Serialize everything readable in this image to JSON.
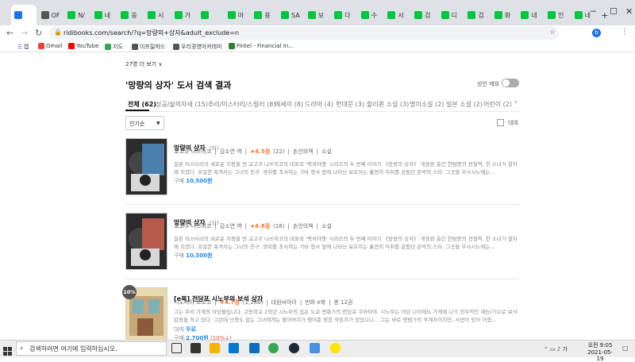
{
  "browser": {
    "tabs": [
      "",
      "OF",
      "N/",
      "네",
      "옹",
      "시",
      "가",
      "",
      "마",
      "용",
      "SA",
      "보",
      "다",
      "수",
      "서",
      "검",
      "디",
      "검",
      "화",
      "내",
      "인",
      "네"
    ],
    "url": "ridibooks.com/search/?q=망량의+상자&adult_exclude=n",
    "bookmarks": [
      "앱",
      "Gmail",
      "YouTube",
      "지도",
      "이프릴하드",
      "우리경영아카데미",
      "Fintel - Financial In..."
    ]
  },
  "page": {
    "more_link": "27명 더 보기 ∨",
    "heading": "'망량의 상자' 도서 검색 결과",
    "adult_exclude_label": "성인 제외",
    "filters": [
      "전체 (62)",
      "성공/삶의자세 (15)",
      "추리/미스터리/스릴러 (8)",
      "에세이 (8)",
      "드라마 (4)",
      "현대문 (3)",
      "할리퀸 소설 (3)",
      "명이소설 (2)",
      "일본 소설 (2)",
      "어린이 (2)"
    ],
    "sort_select": "인기순",
    "rent_label": "대여",
    "books": [
      {
        "title": "망량의 상자",
        "title_suffix": "(하)",
        "author": "교고쿠 나쓰히코",
        "translator": "김소연 역",
        "rating": "★4.5점",
        "rating_count": "(22)",
        "publisher": "손안의책",
        "category": "소설",
        "desc": "일본 미스터리의 새로운 지평을 연 교고쿠 나쓰히코의 대표작 '백귀야행' 시리즈의 두 번째 이야기 《망량의 상자》 개정판 출간 한밤중의 전철역, 한 소녀가 열차에 치였다. 유일한 목격자는 그녀의 친구. 경위를 조사하는 기바 형사 앞에 나타난 보호자는 홀연히 자취를 감췄던 은막의 스타. 그곳을 무사시노에는...",
        "price_label": "구매",
        "price": "10,500원"
      },
      {
        "title": "망량의 상자",
        "title_suffix": "(상)",
        "author": "교고쿠 나쓰히코",
        "translator": "김소연 역",
        "rating": "★4.8점",
        "rating_count": "(16)",
        "publisher": "손안의책",
        "category": "소설",
        "desc": "일본 미스터리의 새로운 지평을 연 교고쿠 나쓰히코의 대표작 '백귀야행' 시리즈의 두 번째 이야기 《망량의 상자》 개정판 출간 한밤중의 전철역, 한 소녀가 열차에 치였다. 유일한 목격자는 그녀의 친구. 경위를 조사하는 기바 형사 앞에 나타난 보호자는 홀연히 자취를 감췄던 은막의 스타. 그곳을 무사시노에는...",
        "price_label": "구매",
        "price": "10,500원"
      },
      {
        "title": "[e북] 전당포 시노부의 보석 상자",
        "author": "니노미야 토모코",
        "rating": "★4.7점",
        "rating_count": "(1,286)",
        "publisher": "대원씨아이",
        "category": "만화 e북",
        "volumes": "총 12권",
        "badge": "10%",
        "desc": "그는 우리 가게의 자당물입니다. 고등학교 2학년 시노부의 집은 도쿄 변화가의 전당포 쿠라타야. 시노부는 어린 나이에도 가게에 나가 천부적인 재능(?)으로 보석 감정을 하고 있다. 그런데 난청도 없는 그녀에게는 할아버지가 맺어준 정한 약혼자가 있었으니... 그는 바로 평범가의 후계자이지만, 사연이 있어 어렸...",
        "rent_row": "대여",
        "rent_price": "무료",
        "price_label": "구매",
        "price": "2,700원",
        "discount": "(10%↓)"
      }
    ]
  },
  "taskbar": {
    "search_placeholder": "검색하려면 여기에 입력하십시오.",
    "time": "오전 9:05",
    "date": "2021-05-19"
  }
}
